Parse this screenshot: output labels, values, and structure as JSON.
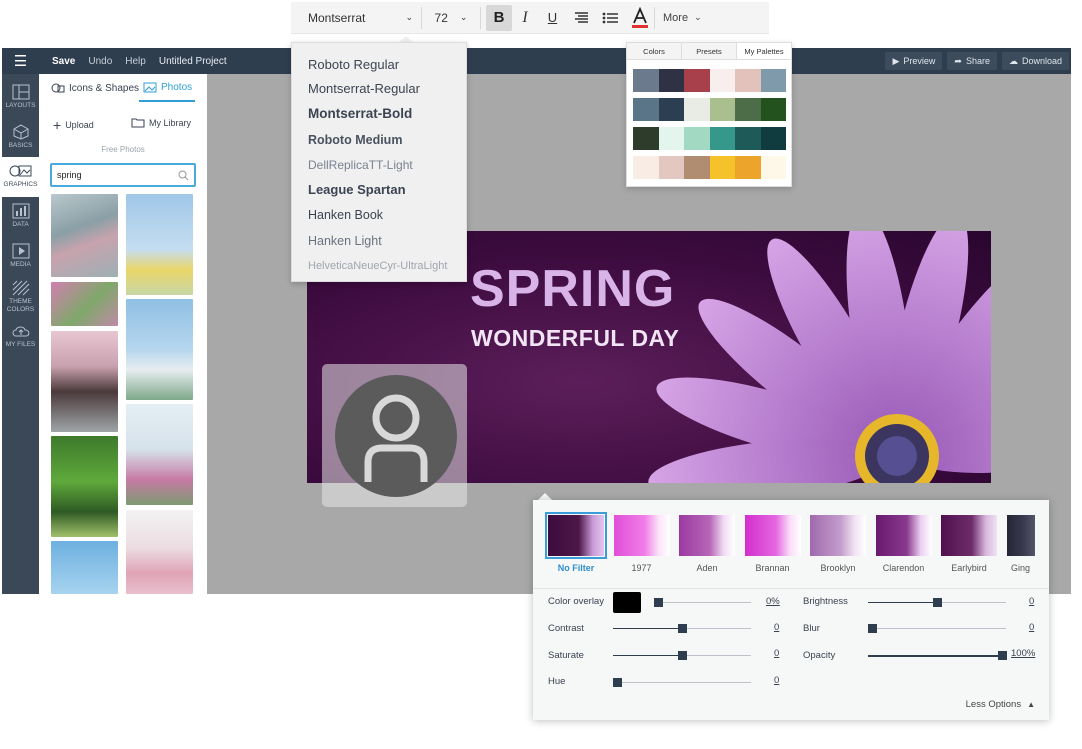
{
  "topbar": {
    "save": "Save",
    "undo": "Undo",
    "help": "Help",
    "title": "Untitled Project",
    "preview": "Preview",
    "share": "Share",
    "download": "Download"
  },
  "rail": [
    {
      "label": "LAYOUTS",
      "icon": "layouts-icon"
    },
    {
      "label": "BASICS",
      "icon": "cube-icon"
    },
    {
      "label": "GRAPHICS",
      "icon": "graphics-icon"
    },
    {
      "label": "DATA",
      "icon": "chart-icon"
    },
    {
      "label": "MEDIA",
      "icon": "play-icon"
    },
    {
      "label": "THEME COLORS",
      "icon": "stripes-icon"
    },
    {
      "label": "MY FILES",
      "icon": "cloud-upload-icon"
    }
  ],
  "panel": {
    "tab_icons": "Icons & Shapes",
    "tab_photos": "Photos",
    "upload": "Upload",
    "library": "My Library",
    "free": "Free Photos",
    "search_value": "spring"
  },
  "toolbar": {
    "font": "Montserrat",
    "size": "72",
    "bold": "B",
    "italic": "I",
    "underline": "U",
    "more": "More",
    "text_color": "#e0342f"
  },
  "font_menu": [
    "Roboto Regular",
    "Montserrat-Regular",
    "Montserrat-Bold",
    "Roboto Medium",
    "DellReplicaTT-Light",
    "League Spartan",
    "Hanken Book",
    "Hanken Light",
    "HelveticaNeueCyr-UltraLight"
  ],
  "palette": {
    "tabs": [
      "Colors",
      "Presets",
      "My Palettes"
    ],
    "rows": [
      [
        "#6b7a8c",
        "#2e3244",
        "#a8404c",
        "#f8eeee",
        "#e4c2bc",
        "#7f9aab"
      ],
      [
        "#5a7488",
        "#2c3e52",
        "#e8ece4",
        "#a9c08e",
        "#4c6d48",
        "#24521f"
      ],
      [
        "#2d3c2b",
        "#e4f5ee",
        "#a2d9c2",
        "#36988a",
        "#1e5a58",
        "#103c40"
      ],
      [
        "#f8ece4",
        "#e2c8c0",
        "#b08c70",
        "#f6c22a",
        "#eca52a",
        "#fdf8e8"
      ]
    ]
  },
  "banner": {
    "title": "SPRING",
    "subtitle": "WONDERFUL DAY"
  },
  "filters": {
    "names": [
      "No Filter",
      "1977",
      "Aden",
      "Brannan",
      "Brooklyn",
      "Clarendon",
      "Earlybird",
      "Ging"
    ],
    "color_overlay": {
      "label": "Color overlay",
      "value": "0%",
      "color": "#000000"
    },
    "contrast": {
      "label": "Contrast",
      "value": "0"
    },
    "saturate": {
      "label": "Saturate",
      "value": "0"
    },
    "hue": {
      "label": "Hue",
      "value": "0"
    },
    "brightness": {
      "label": "Brightness",
      "value": "0"
    },
    "blur": {
      "label": "Blur",
      "value": "0"
    },
    "opacity": {
      "label": "Opacity",
      "value": "100%"
    },
    "less": "Less Options"
  }
}
